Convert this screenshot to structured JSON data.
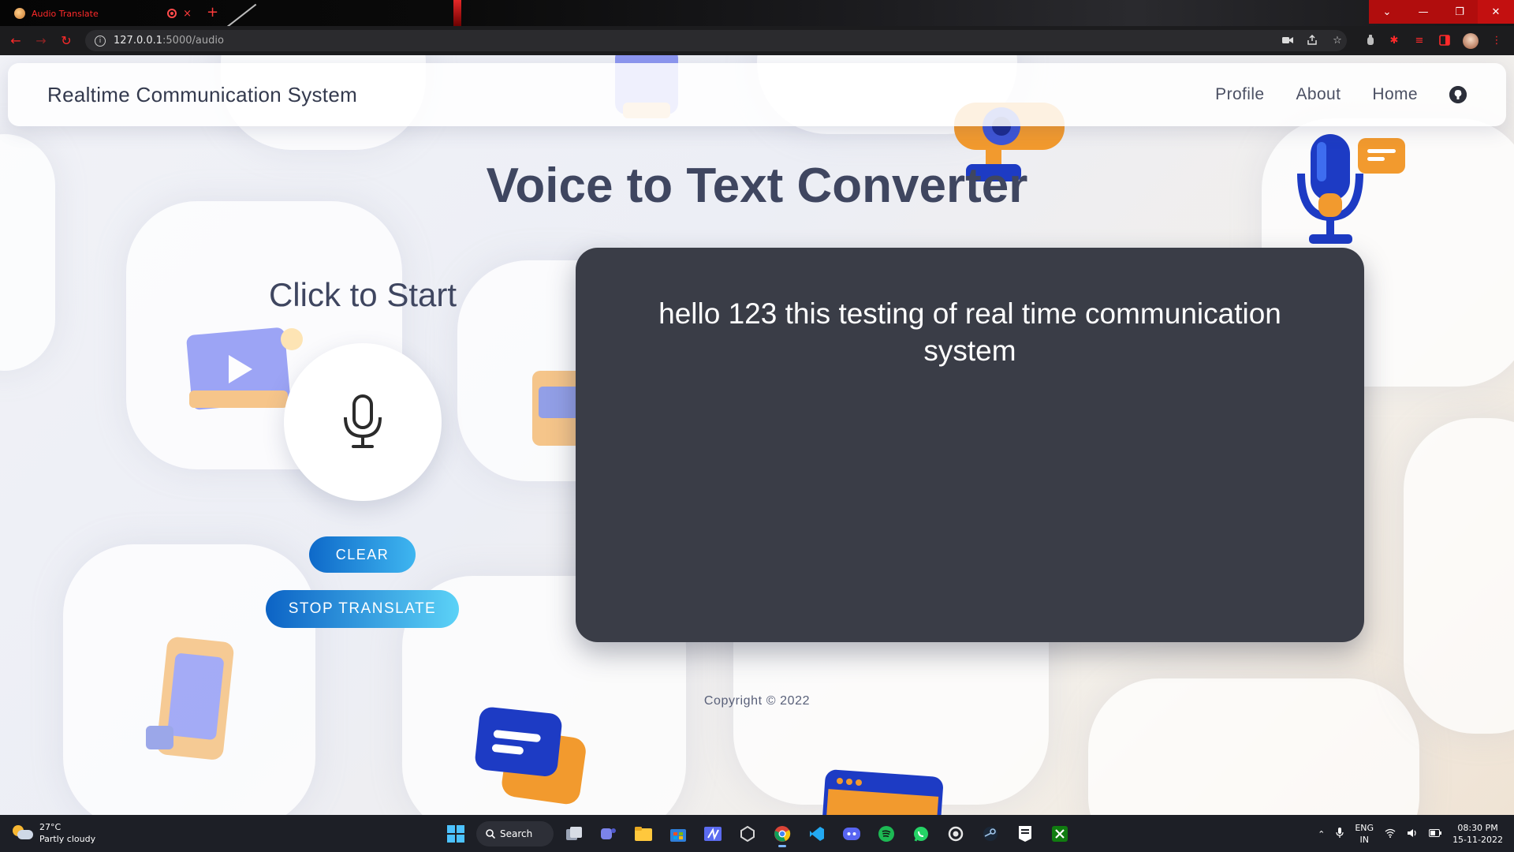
{
  "browser": {
    "tab_title": "Audio Translate",
    "url_host": "127.0.0.1",
    "url_rest": ":5000/audio",
    "new_tab_label": "+",
    "tab_close_label": "×"
  },
  "window_controls": {
    "dropdown": "⌄",
    "minimize": "—",
    "restore": "❐",
    "close": "✕"
  },
  "navbar": {
    "brand": "Realtime Communication System",
    "links": [
      "Profile",
      "About",
      "Home"
    ],
    "github_icon": "github-icon"
  },
  "main": {
    "title": "Voice to Text Converter",
    "start_label": "Click to Start",
    "mic_icon": "microphone-icon",
    "clear_label": "CLEAR",
    "stop_label": "STOP TRANSLATE",
    "transcript": "hello 123 this testing of real time communication system"
  },
  "footer": {
    "copyright": "Copyright © 2022"
  },
  "taskbar": {
    "weather_temp": "27°C",
    "weather_desc": "Partly cloudy",
    "search_label": "Search",
    "lang_top": "ENG",
    "lang_bottom": "IN",
    "time": "08:30 PM",
    "date": "15-11-2022"
  },
  "colors": {
    "accent_red": "#ff2a2a",
    "panel_bg": "#3a3d47",
    "button_gradient_start": "#0e69c9",
    "button_gradient_end": "#3fb6f0",
    "heading": "#3f4660"
  }
}
